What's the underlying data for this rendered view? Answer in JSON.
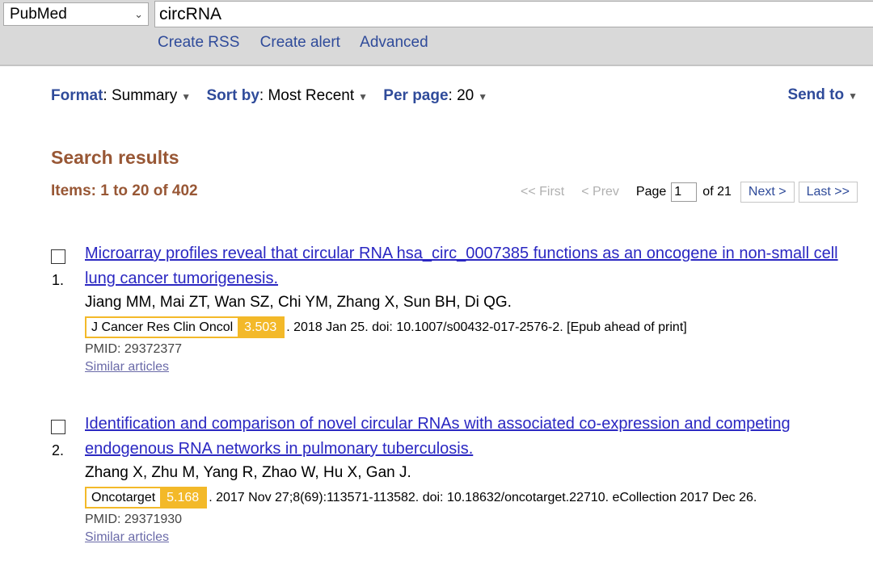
{
  "search": {
    "database": "PubMed",
    "query": "circRNA",
    "links": [
      "Create RSS",
      "Create alert",
      "Advanced"
    ]
  },
  "display": {
    "format_label": "Format",
    "format_value": "Summary",
    "sort_label": "Sort by",
    "sort_value": "Most Recent",
    "perpage_label": "Per page",
    "perpage_value": "20",
    "send_to": "Send to"
  },
  "results_heading": "Search results",
  "items_text": "Items: 1 to 20 of 402",
  "pager": {
    "first": "<< First",
    "prev": "< Prev",
    "page_label": "Page",
    "page_value": "1",
    "of_text": "of 21",
    "next": "Next >",
    "last": "Last >>"
  },
  "results": [
    {
      "number": "1.",
      "title": "Microarray profiles reveal that circular RNA hsa_circ_0007385 functions as an oncogene in non-small cell lung cancer tumorigenesis.",
      "authors": "Jiang MM, Mai ZT, Wan SZ, Chi YM, Zhang X, Sun BH, Di QG.",
      "journal": "J Cancer Res Clin Oncol",
      "impact_factor": "3.503",
      "citation": ". 2018 Jan 25. doi: 10.1007/s00432-017-2576-2. [Epub ahead of print]",
      "pmid": "PMID: 29372377",
      "similar": "Similar articles"
    },
    {
      "number": "2.",
      "title": "Identification and comparison of novel circular RNAs with associated co-expression and competing endogenous RNA networks in pulmonary tuberculosis.",
      "authors": "Zhang X, Zhu M, Yang R, Zhao W, Hu X, Gan J.",
      "journal": "Oncotarget",
      "impact_factor": "5.168",
      "citation": ". 2017 Nov 27;8(69):113571-113582. doi: 10.18632/oncotarget.22710. eCollection 2017 Dec 26.",
      "pmid": "PMID: 29371930",
      "similar": "Similar articles"
    }
  ],
  "colors": {
    "link": "#2f4b9a",
    "title_link": "#2a27c2",
    "heading": "#985735",
    "badge": "#f3b929",
    "topbar": "#d9d9d9"
  }
}
